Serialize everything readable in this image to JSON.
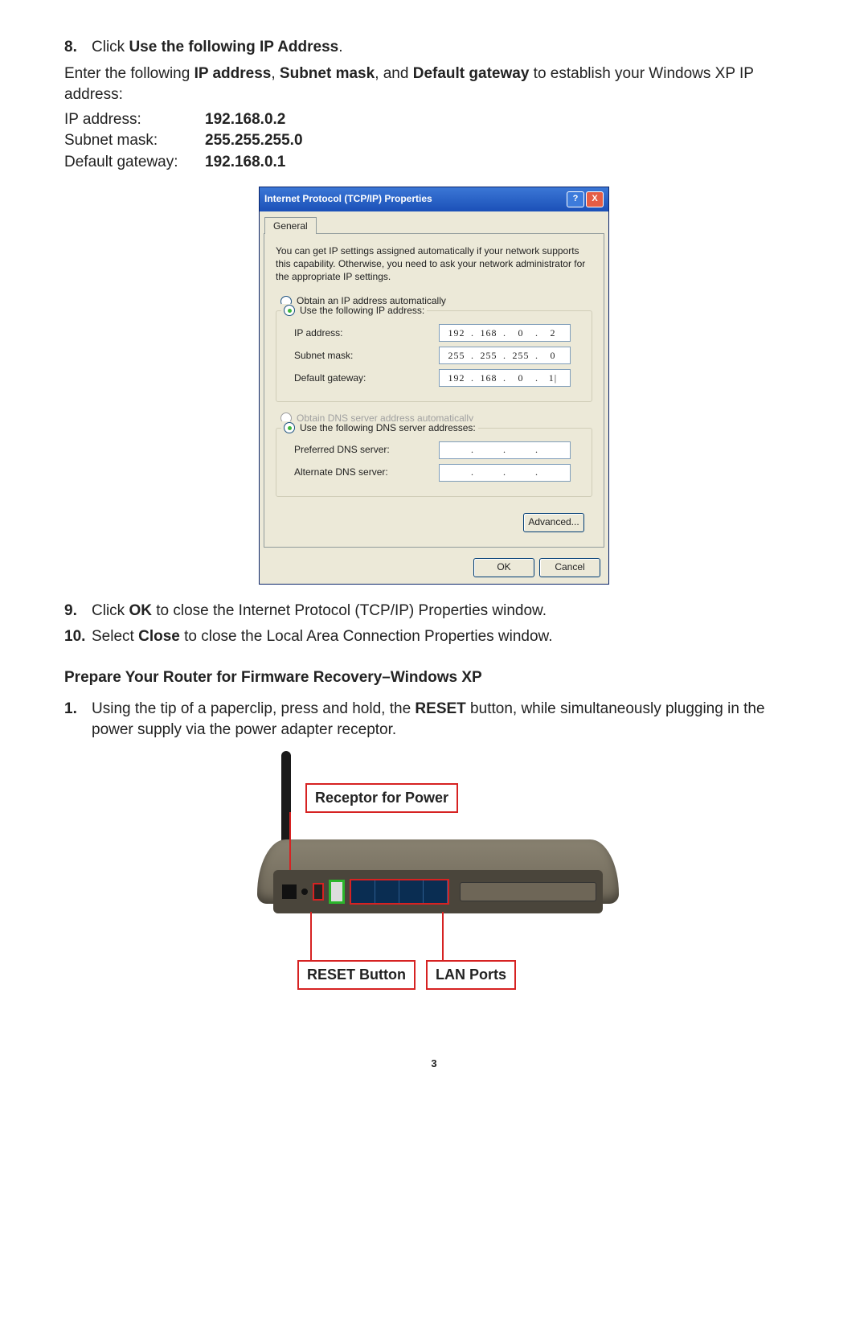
{
  "step8": {
    "num": "8.",
    "pre": "Click ",
    "bold": "Use the following IP Address",
    "post": "."
  },
  "intro": {
    "p1a": "Enter the following ",
    "p1b": "IP address",
    "p1c": ", ",
    "p1d": "Subnet mask",
    "p1e": ", and ",
    "p1f": "Default gateway",
    "p1g": " to establish your Windows XP IP address:"
  },
  "iptable": {
    "ip_lab": "IP address:",
    "ip_val": "192.168.0.2",
    "sm_lab": "Subnet mask:",
    "sm_val": "255.255.255.0",
    "gw_lab": "Default gateway:",
    "gw_val": "192.168.0.1"
  },
  "dialog": {
    "title": "Internet Protocol (TCP/IP) Properties",
    "tab": "General",
    "desc": "You can get IP settings assigned automatically if your network supports this capability. Otherwise, you need to ask your network administrator for the appropriate IP settings.",
    "r1": "Obtain an IP address automatically",
    "r2": "Use the following IP address:",
    "f_ip": "IP address:",
    "v_ip": [
      "192",
      "168",
      "0",
      "2"
    ],
    "f_sm": "Subnet mask:",
    "v_sm": [
      "255",
      "255",
      "255",
      "0"
    ],
    "f_gw": "Default gateway:",
    "v_gw": [
      "192",
      "168",
      "0",
      "1|"
    ],
    "r3": "Obtain DNS server address automatically",
    "r4": "Use the following DNS server addresses:",
    "f_pd": "Preferred DNS server:",
    "f_ad": "Alternate DNS server:",
    "btn_adv": "Advanced...",
    "btn_ok": "OK",
    "btn_cancel": "Cancel"
  },
  "step9": {
    "num": "9.",
    "a": "Click ",
    "b": "OK",
    "c": " to close the Internet Protocol (TCP/IP) Properties window."
  },
  "step10": {
    "num": "10.",
    "a": "Select ",
    "b": "Close",
    "c": " to close the Local Area Connection Properties window."
  },
  "section": "Prepare Your Router for Firmware Recovery–Windows XP",
  "step1b": {
    "num": "1.",
    "a": "Using the tip of a paperclip, press and hold, the ",
    "b": "RESET",
    "c": " button, while simultaneously plugging in the power supply via the power adapter receptor."
  },
  "router": {
    "c1": "Receptor for Power",
    "c2": "RESET Button",
    "c3": "LAN Ports"
  },
  "page": "3"
}
